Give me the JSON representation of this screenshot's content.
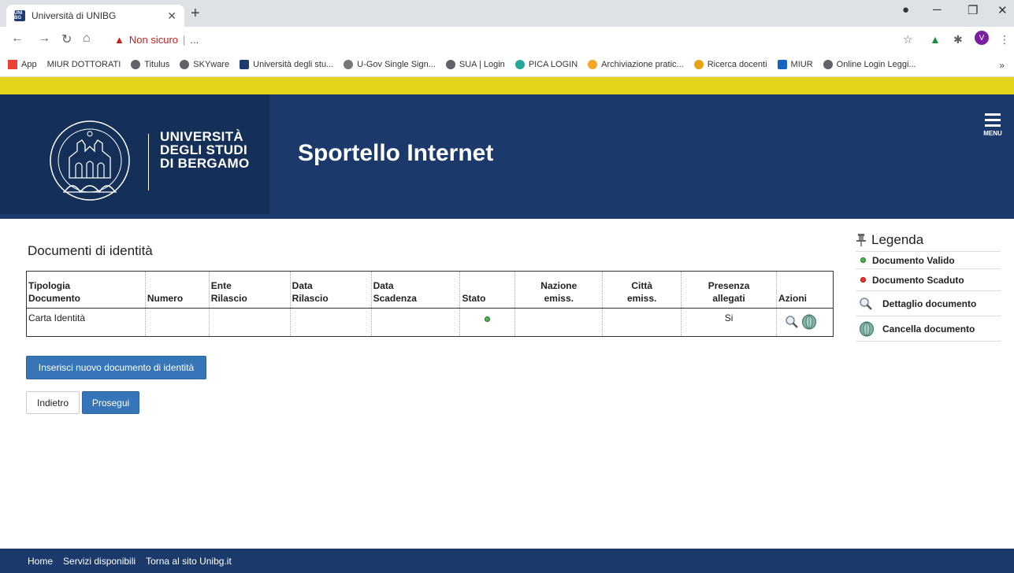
{
  "browser": {
    "tab_title": "Università di UNIBG",
    "tab_favicon_text": "UNI BG",
    "address_security_label": "Non sicuro",
    "address_url": "...",
    "avatar_initial": "V",
    "bookmarks": [
      "App",
      "MIUR DOTTORATI",
      "Titulus",
      "SKYware",
      "Università degli stu...",
      "U-Gov Single Sign...",
      "SUA | Login",
      "PICA LOGIN",
      "Archiviazione pratic...",
      "Ricerca docenti",
      "MIUR",
      "Online Login Leggi..."
    ],
    "bookmarks_more": "»"
  },
  "header": {
    "uni_name_lines": [
      "UNIVERSITÀ",
      "DEGLI STUDI",
      "DI BERGAMO"
    ],
    "portal_title": "Sportello Internet",
    "menu_label": "MENU"
  },
  "main": {
    "section_title": "Documenti di identità",
    "table": {
      "columns": [
        [
          "Tipologia",
          "Documento"
        ],
        [
          "",
          "Numero"
        ],
        [
          "Ente",
          "Rilascio"
        ],
        [
          "Data",
          "Rilascio"
        ],
        [
          "Data",
          "Scadenza"
        ],
        [
          "",
          "Stato"
        ],
        [
          "Nazione",
          "emiss."
        ],
        [
          "Città",
          "emiss."
        ],
        [
          "Presenza",
          "allegati"
        ],
        [
          "",
          "Azioni"
        ]
      ],
      "rows": [
        {
          "tipologia": "Carta Identità",
          "numero": "",
          "ente_rilascio": "",
          "data_rilascio": "",
          "data_scadenza": "",
          "stato": "valid",
          "nazione_emiss": "",
          "citta_emiss": "",
          "presenza_allegati": "Si"
        }
      ]
    },
    "insert_button": "Inserisci nuovo documento di identità",
    "back_button": "Indietro",
    "next_button": "Prosegui"
  },
  "legend": {
    "title": "Legenda",
    "items": [
      "Documento Valido",
      "Documento Scaduto",
      "Dettaglio documento",
      "Cancella documento"
    ]
  },
  "footer": {
    "links": [
      "Home",
      "Servizi disponibili",
      "Torna al sito Unibg.it"
    ]
  },
  "colors": {
    "header_blue": "#1b3a6b",
    "yellow_bar": "#e6d41c",
    "button_blue": "#3575b8",
    "valid_green": "#4caf50",
    "expired_red": "#e53935"
  }
}
